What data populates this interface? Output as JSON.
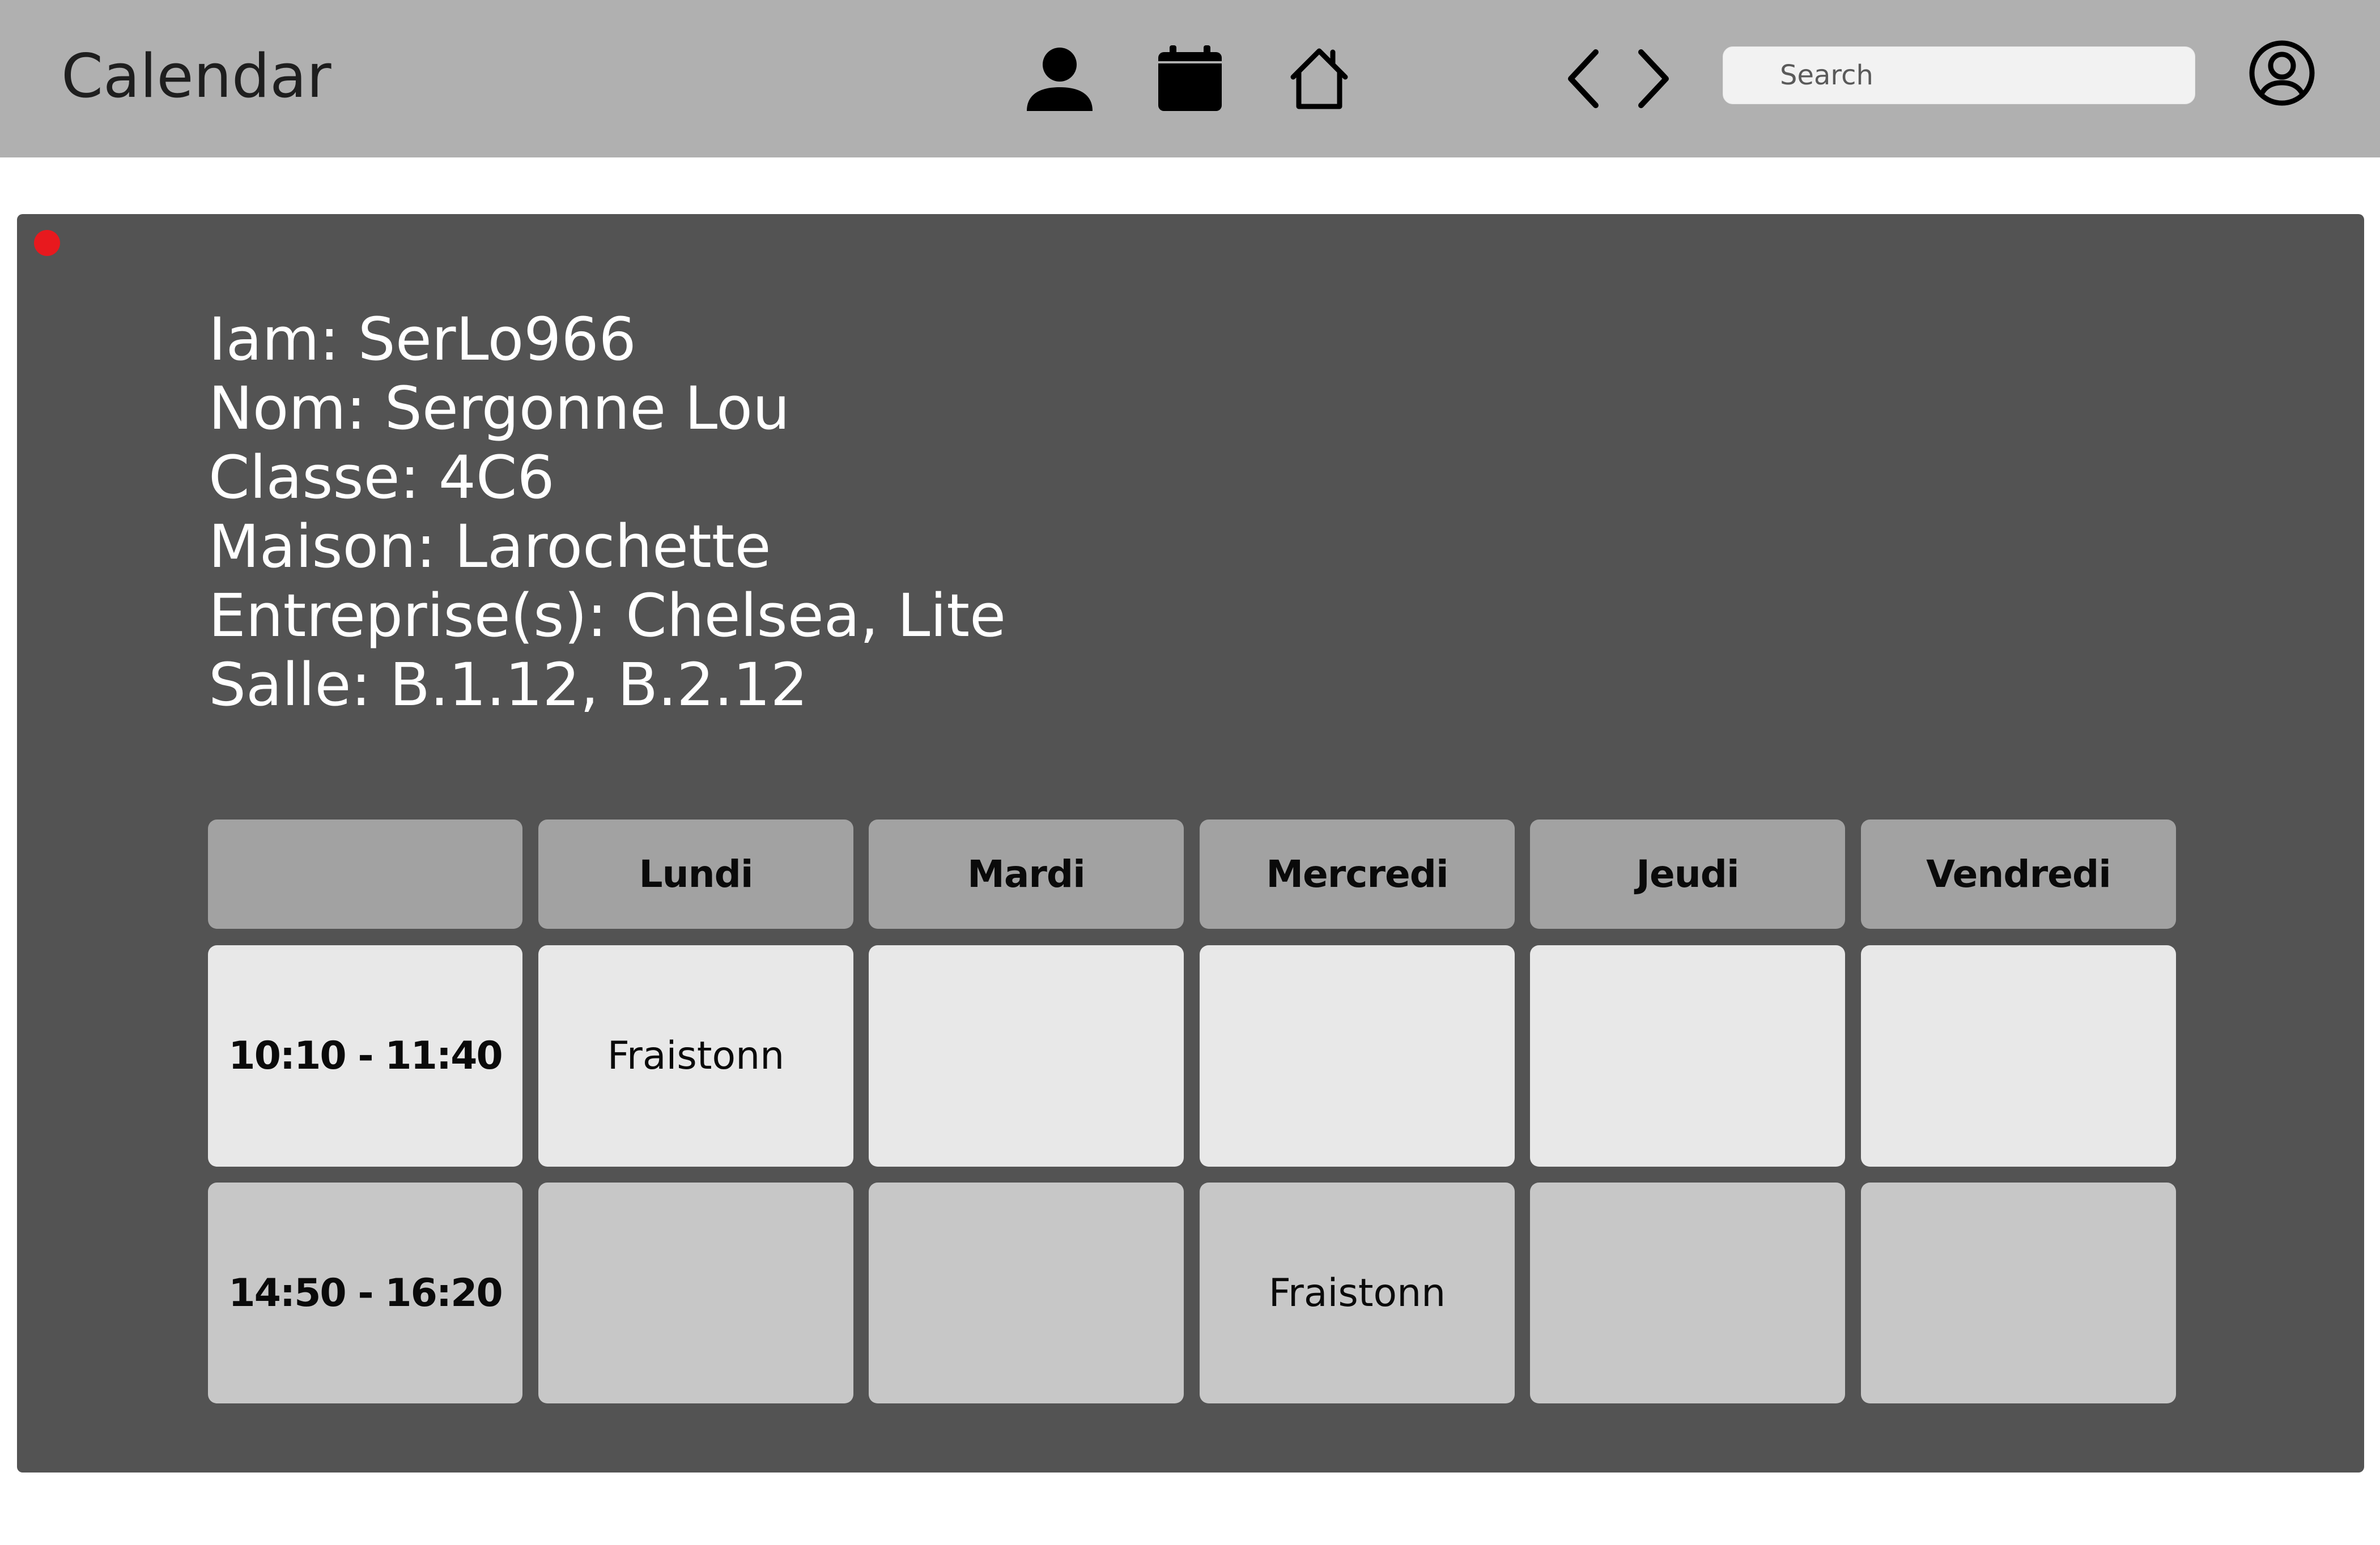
{
  "header": {
    "title": "Calendar",
    "search_placeholder": "Search",
    "icons": [
      "user-icon",
      "calendar-icon",
      "home-icon",
      "chevron-left-icon",
      "chevron-right-icon",
      "account-circle-icon"
    ]
  },
  "status": {
    "color": "#e8191e"
  },
  "profile": {
    "iam": "Iam: SerLo966",
    "nom": "Nom: Sergonne Lou",
    "classe": "Classe: 4C6",
    "maison": "Maison: Larochette",
    "entreprises": "Entreprise(s): Chelsea, Lite",
    "salle": "Salle: B.1.12, B.2.12"
  },
  "timetable": {
    "days": [
      "Lundi",
      "Mardi",
      "Mercredi",
      "Jeudi",
      "Vendredi"
    ],
    "slots": [
      {
        "time": "10:10 - 11:40",
        "cells": [
          "Fraistonn",
          "",
          "",
          "",
          ""
        ]
      },
      {
        "time": "14:50 - 16:20",
        "cells": [
          "",
          "",
          "Fraistonn",
          "",
          ""
        ]
      }
    ]
  },
  "colors": {
    "topbar": "#b0b0b0",
    "panel": "#535353",
    "header_cell": "#a2a2a2",
    "row1_cell": "#e8e8e8",
    "row2_cell": "#c7c7c7"
  }
}
